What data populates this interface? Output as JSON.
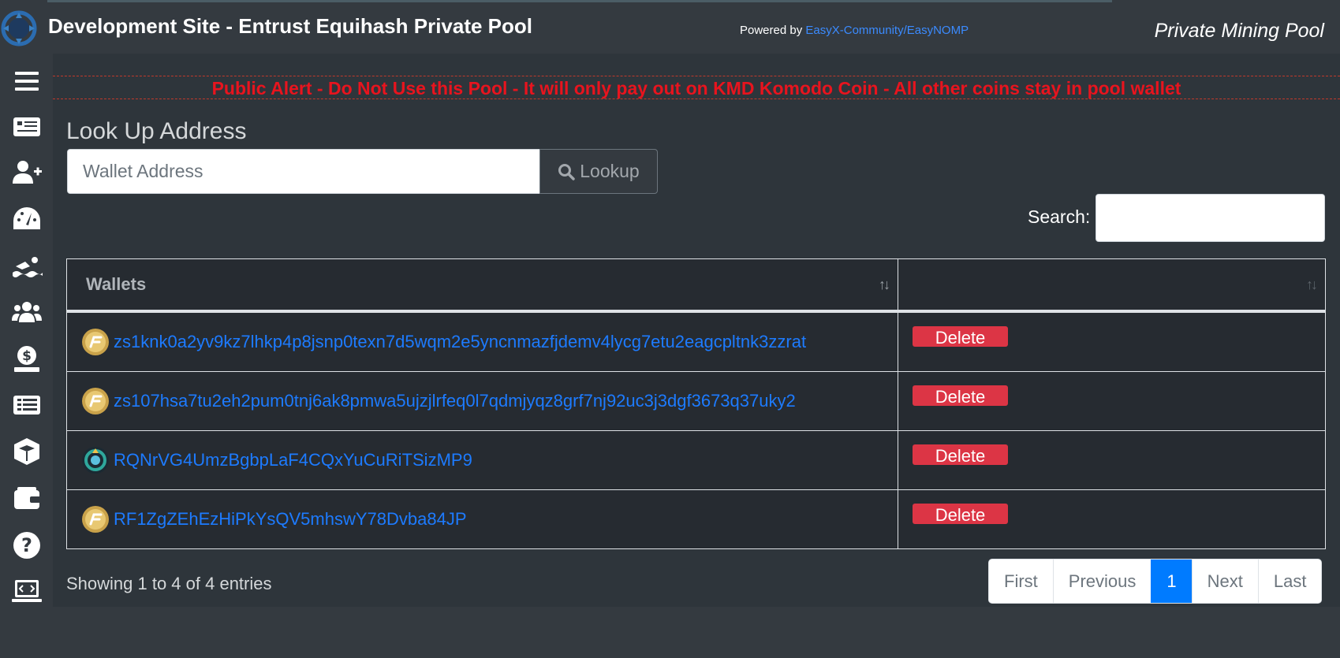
{
  "header": {
    "title": "Development Site - Entrust Equihash Private Pool",
    "powered_prefix": "Powered by ",
    "powered_link": "EasyX-Community/EasyNOMP",
    "brand_right": "Private Mining Pool"
  },
  "sidebar": {
    "items": [
      "menu-icon",
      "news-icon",
      "add-user-icon",
      "dashboard-gauge-icon",
      "swimmer-icon",
      "workers-icon",
      "payments-icon",
      "list-icon",
      "blocks-cube-icon",
      "wallet-icon",
      "help-icon",
      "api-icon"
    ]
  },
  "alert": "Public Alert - Do Not Use this Pool - It will only pay out on KMD Komodo Coin - All other coins stay in pool wallet",
  "lookup": {
    "title": "Look Up Address",
    "placeholder": "Wallet Address",
    "button_label": "Lookup"
  },
  "search": {
    "label": "Search:"
  },
  "table": {
    "columns": [
      "Wallets",
      ""
    ],
    "rows": [
      {
        "address": "zs1knk0a2yv9kz7lhkp4p8jsnp0texn7d5wqm2e5yncnmazfjdemv4lycg7etu2eagcpltnk3zzrat",
        "coin": "gold",
        "action": "Delete"
      },
      {
        "address": "zs107hsa7tu2eh2pum0tnj6ak8pmwa5ujzjlrfeq0l7qdmjyqz8grf7nj92uc3j3dgf3673q37uky2",
        "coin": "gold",
        "action": "Delete"
      },
      {
        "address": "RQNrVG4UmzBgbpLaF4CQxYuCuRiTSizMP9",
        "coin": "teal",
        "action": "Delete"
      },
      {
        "address": "RF1ZgZEhEzHiPkYsQV5mhswY78Dvba84JP",
        "coin": "gold",
        "action": "Delete"
      }
    ]
  },
  "info": "Showing 1 to 4 of 4 entries",
  "pagination": {
    "first": "First",
    "previous": "Previous",
    "current": "1",
    "next": "Next",
    "last": "Last"
  },
  "colors": {
    "accent": "#007bff",
    "alert": "#e8141e",
    "danger": "#dc3545"
  }
}
